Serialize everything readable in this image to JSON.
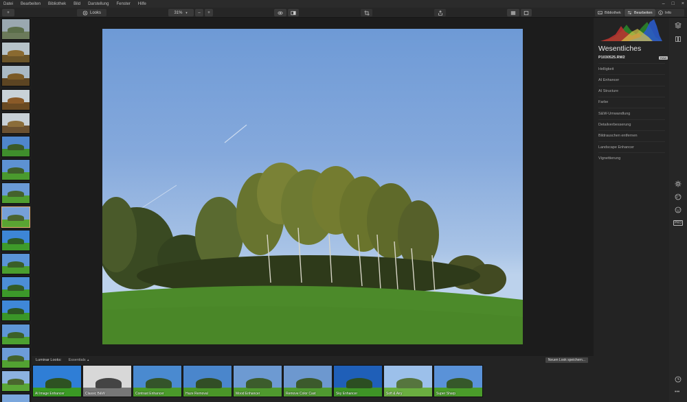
{
  "menu": {
    "items": [
      "Datei",
      "Bearbeiten",
      "Bibliothek",
      "Bild",
      "Darstellung",
      "Fenster",
      "Hilfe"
    ],
    "window_controls": [
      "–",
      "□",
      "×"
    ]
  },
  "toolbar": {
    "add_label": "+",
    "looks_label": "Looks",
    "zoom_value": "31%",
    "zoom_minus": "–",
    "zoom_plus": "+",
    "library_tab": "Bibliothek",
    "edit_tab": "Bearbeiten",
    "info_tab": "Info"
  },
  "filmstrip": {
    "selected_index": 8,
    "thumbs": [
      {
        "sky": "#9aa8b0",
        "grass": "#6b7a5a",
        "trees": "#5b6e4a"
      },
      {
        "sky": "#b7c3c9",
        "grass": "#6a5428",
        "trees": "#8a6a30"
      },
      {
        "sky": "#a9b9c4",
        "grass": "#5c4422",
        "trees": "#7a5a26"
      },
      {
        "sky": "#c9d2d8",
        "grass": "#6a4a22",
        "trees": "#8a5a28"
      },
      {
        "sky": "#c8d0d6",
        "grass": "#6a5030",
        "trees": "#8b6d3a"
      },
      {
        "sky": "#4f86cc",
        "grass": "#3f8e2c",
        "trees": "#3a5a28"
      },
      {
        "sky": "#5d92d2",
        "grass": "#4a9a2e",
        "trees": "#3e5e2a"
      },
      {
        "sky": "#6a9ad6",
        "grass": "#4f9e30",
        "trees": "#44622c"
      },
      {
        "sky": "#76a0d8",
        "grass": "#5aa432",
        "trees": "#4a6430"
      },
      {
        "sky": "#3d86d6",
        "grass": "#3e9a2a",
        "trees": "#2e5a24"
      },
      {
        "sky": "#5a94d6",
        "grass": "#4a9e2e",
        "trees": "#3a5e28"
      },
      {
        "sky": "#4c8ed6",
        "grass": "#3c982a",
        "trees": "#335c26"
      },
      {
        "sky": "#3f88d8",
        "grass": "#3a9628",
        "trees": "#2c5622"
      },
      {
        "sky": "#5e96d6",
        "grass": "#4ca030",
        "trees": "#3c6028"
      },
      {
        "sky": "#6c9cd8",
        "grass": "#52a232",
        "trees": "#42622c"
      },
      {
        "sky": "#8cb2e0",
        "grass": "#5aa636",
        "trees": "#4a662e"
      },
      {
        "sky": "#7aa6dc",
        "grass": "#6a4030",
        "trees": "#4e6a30"
      }
    ]
  },
  "looks": {
    "header_label": "Luminar Looks:",
    "category": "Essentials",
    "save_button": "Neuen Look speichern...",
    "items": [
      {
        "name": "AI Image Enhancer",
        "sky": "#2f7ed6",
        "grass": "#3a9a24",
        "trees": "#2e5222"
      },
      {
        "name": "Classic B&W",
        "sky": "#d8d8d8",
        "grass": "#777777",
        "trees": "#444444"
      },
      {
        "name": "Contrast Enhancer",
        "sky": "#4a8ad0",
        "grass": "#4a9a2a",
        "trees": "#34542a"
      },
      {
        "name": "Haze Removal",
        "sky": "#4a86cc",
        "grass": "#4a9628",
        "trees": "#324e26"
      },
      {
        "name": "Mood Enhancer",
        "sky": "#6d9ad2",
        "grass": "#4f9a2e",
        "trees": "#3c5c2c"
      },
      {
        "name": "Remove Color Cast",
        "sky": "#6d98cf",
        "grass": "#4f9a30",
        "trees": "#3c5a2c"
      },
      {
        "name": "Sky Enhancer",
        "sky": "#1f5fb8",
        "grass": "#3e9426",
        "trees": "#2c4e22"
      },
      {
        "name": "Soft & Airy",
        "sky": "#9cc0ea",
        "grass": "#6aae40",
        "trees": "#56753e"
      },
      {
        "name": "Super Sharp",
        "sky": "#5a92d8",
        "grass": "#4a9c2a",
        "trees": "#36582a"
      }
    ]
  },
  "panel": {
    "title": "Wesentliches",
    "filename": "P1030525.RW2",
    "raw_badge": "RAW",
    "tools": [
      "Helligkeit",
      "AI Enhancer",
      "AI Structure",
      "Farbe",
      "S&W-Umwandlung",
      "Detailverbesserung",
      "Bildrauschen entfernen",
      "Landscape Enhancer",
      "Vignettierung"
    ]
  },
  "rail": {
    "pro_label": "PRO",
    "more_label": "•••"
  }
}
